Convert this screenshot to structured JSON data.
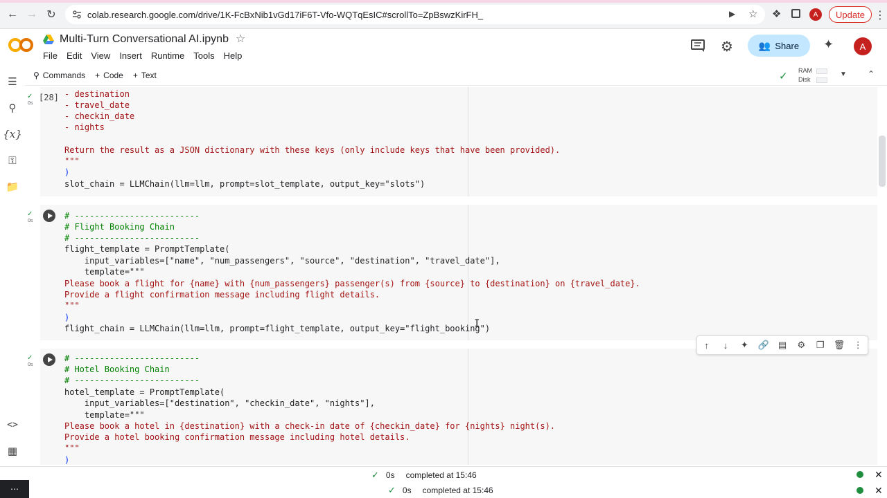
{
  "browser": {
    "url": "colab.research.google.com/drive/1K-FcBxNib1vGd17iF6T-Vfo-WQTqEsIC#scrollTo=ZpBswzKirFH_",
    "update_label": "Update",
    "avatar_letter": "A"
  },
  "header": {
    "title": "Multi-Turn Conversational AI.ipynb",
    "menu": [
      "File",
      "Edit",
      "View",
      "Insert",
      "Runtime",
      "Tools",
      "Help"
    ],
    "share_label": "Share",
    "avatar_letter": "A",
    "logo_text": "CO"
  },
  "toolbar": {
    "commands_label": "Commands",
    "code_label": "Code",
    "text_label": "Text",
    "ram_label": "RAM",
    "disk_label": "Disk"
  },
  "cells": {
    "cell1": {
      "exec_count": "[28]",
      "time": "0s",
      "lines": [
        "- destination",
        "- travel_date",
        "- checkin_date",
        "- nights",
        "",
        "Return the result as a JSON dictionary with these keys (only include keys that have been provided).",
        "\"\"\"",
        ")",
        "slot_chain = LLMChain(llm=llm, prompt=slot_template, output_key=\"slots\")"
      ]
    },
    "cell2": {
      "time": "0s",
      "lines": [
        "# -------------------------",
        "# Flight Booking Chain",
        "# -------------------------",
        "flight_template = PromptTemplate(",
        "    input_variables=[\"name\", \"num_passengers\", \"source\", \"destination\", \"travel_date\"],",
        "    template=\"\"\"",
        "Please book a flight for {name} with {num_passengers} passenger(s) from {source} to {destination} on {travel_date}.",
        "Provide a flight confirmation message including flight details.",
        "\"\"\"",
        ")",
        "flight_chain = LLMChain(llm=llm, prompt=flight_template, output_key=\"flight_booking\")"
      ]
    },
    "cell3": {
      "time": "0s",
      "lines": [
        "# -------------------------",
        "# Hotel Booking Chain",
        "# -------------------------",
        "hotel_template = PromptTemplate(",
        "    input_variables=[\"destination\", \"checkin_date\", \"nights\"],",
        "    template=\"\"\"",
        "Please book a hotel in {destination} with a check-in date of {checkin_date} for {nights} night(s).",
        "Provide a hotel booking confirmation message including hotel details.",
        "\"\"\"",
        ")"
      ]
    }
  },
  "status_bar": {
    "row1_time": "0s",
    "row1_text": "completed at 15:46",
    "row2_time": "0s",
    "row2_text": "completed at 15:46"
  },
  "colors": {
    "accent": "#c2e7ff",
    "success": "#1e8e3e",
    "string": "#a31515",
    "danger": "#d93025"
  },
  "icons": {
    "rail": [
      "table-of-contents-icon",
      "search-icon",
      "variables-icon",
      "key-icon",
      "folder-icon",
      "code-snippets-icon",
      "terminal-icon"
    ],
    "cell_toolbar": [
      "arrow-up-icon",
      "arrow-down-icon",
      "sparkle-icon",
      "link-icon",
      "comment-icon",
      "gear-icon",
      "mirror-icon",
      "trash-icon",
      "more-vert-icon"
    ]
  }
}
